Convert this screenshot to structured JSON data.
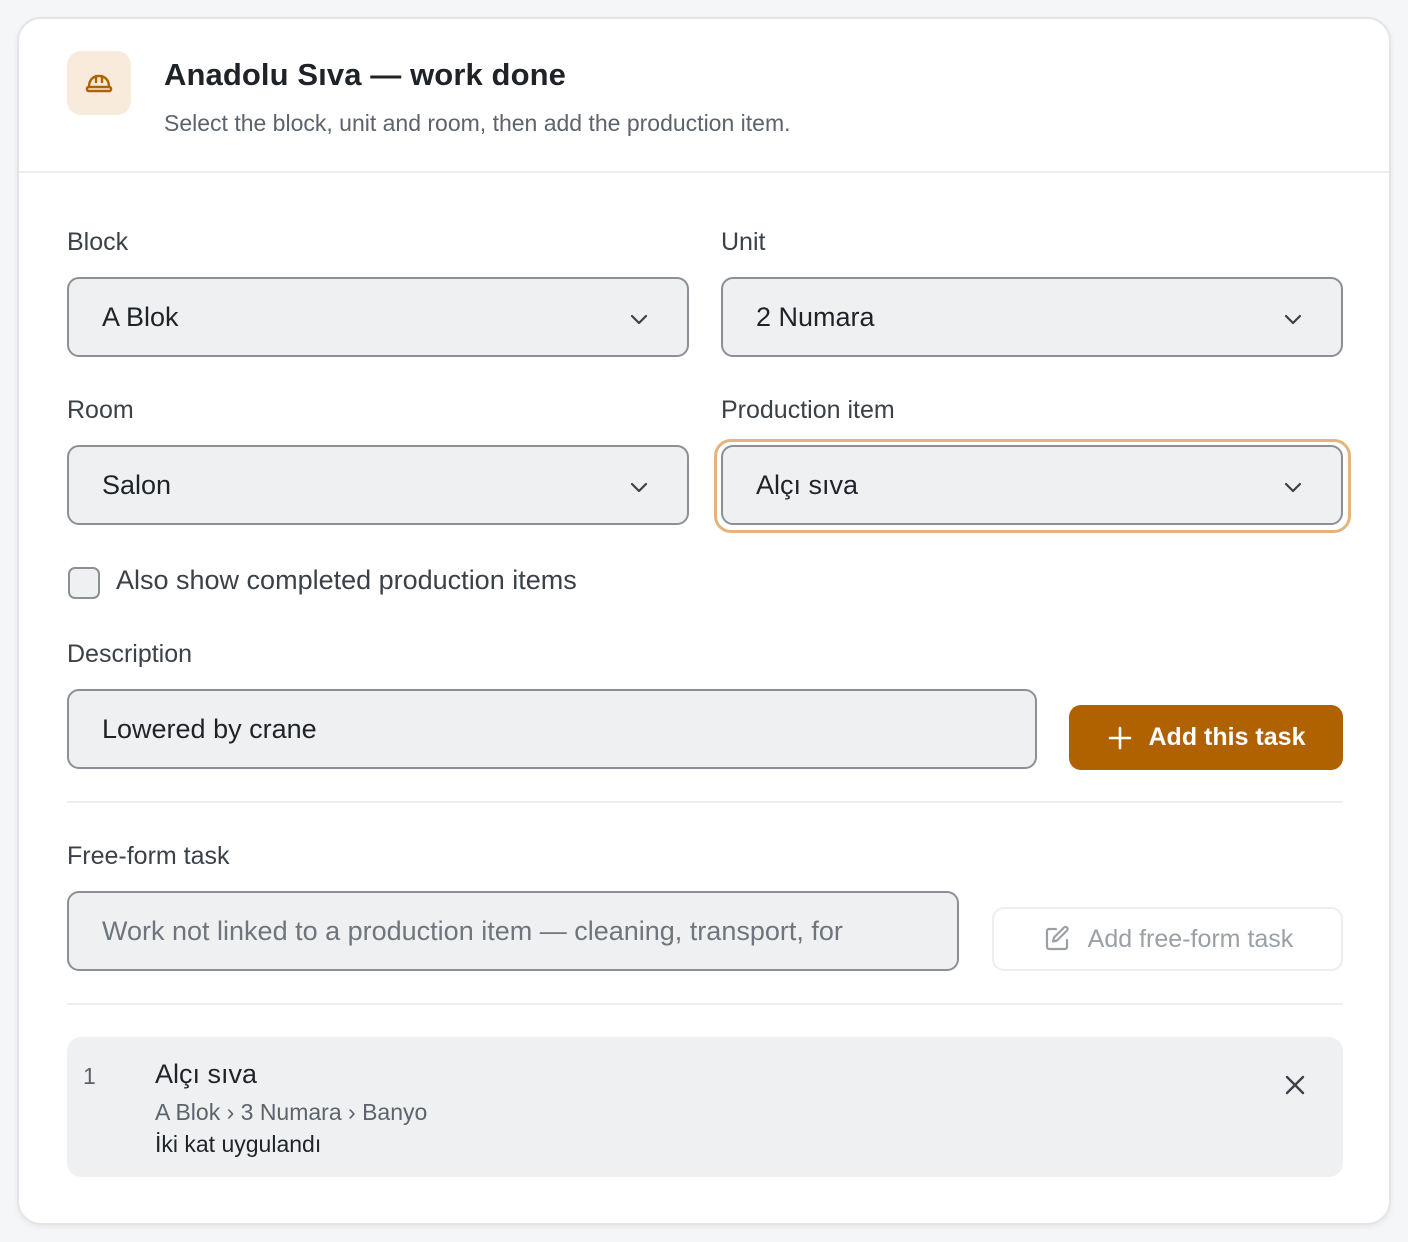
{
  "header": {
    "icon": "hard-hat-icon",
    "title": "Anadolu Sıva — work done",
    "subtitle": "Select the block, unit and room, then add the production item."
  },
  "form": {
    "block": {
      "label": "Block",
      "value": "A Blok"
    },
    "unit": {
      "label": "Unit",
      "value": "2 Numara"
    },
    "room": {
      "label": "Room",
      "value": "Salon"
    },
    "production_item": {
      "label": "Production item",
      "value": "Alçı sıva",
      "focused": true
    },
    "show_completed": {
      "label": "Also show completed production items",
      "checked": false
    },
    "description": {
      "label": "Description",
      "value": "Lowered by crane"
    },
    "add_task_label": "Add this task",
    "free_form": {
      "label": "Free-form task",
      "placeholder": "Work not linked to a production item — cleaning, transport, for",
      "button_label": "Add free-form task"
    }
  },
  "tasks": [
    {
      "number": "1",
      "title": "Alçı sıva",
      "path": "A Blok › 3 Numara › Banyo",
      "description": "İki kat uygulandı"
    }
  ],
  "colors": {
    "accent": "#b06100",
    "focus_ring": "#e3b57c",
    "icon_bg": "#f8ebdc"
  }
}
